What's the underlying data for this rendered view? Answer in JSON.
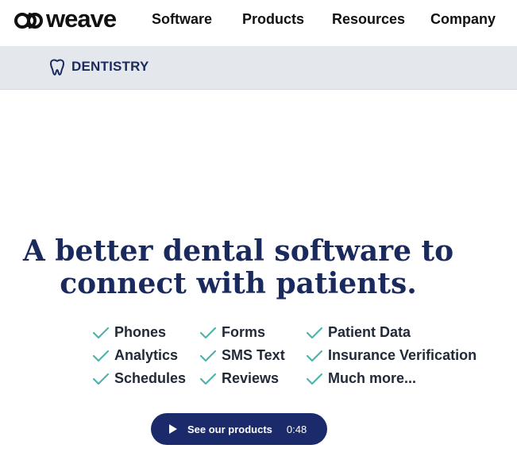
{
  "brand": {
    "name": "weave"
  },
  "nav": {
    "items": [
      {
        "label": "Software"
      },
      {
        "label": "Products"
      },
      {
        "label": "Resources"
      },
      {
        "label": "Company"
      }
    ]
  },
  "subnav": {
    "label": "DENTISTRY",
    "icon": "tooth-icon"
  },
  "hero": {
    "headline_line1": "A better dental software to",
    "headline_line2": "connect with patients.",
    "features": [
      [
        "Phones",
        "Forms",
        "Patient Data"
      ],
      [
        "Analytics",
        "SMS Text",
        "Insurance Verification"
      ],
      [
        "Schedules",
        "Reviews",
        "Much more..."
      ]
    ],
    "cta": {
      "label": "See our products",
      "duration": "0:48",
      "icon": "play-icon"
    }
  },
  "colors": {
    "navy": "#1b2a5c",
    "check": "#4fb3a9",
    "subnav_bg": "#e4e8ec",
    "button": "#1b2a6b"
  }
}
